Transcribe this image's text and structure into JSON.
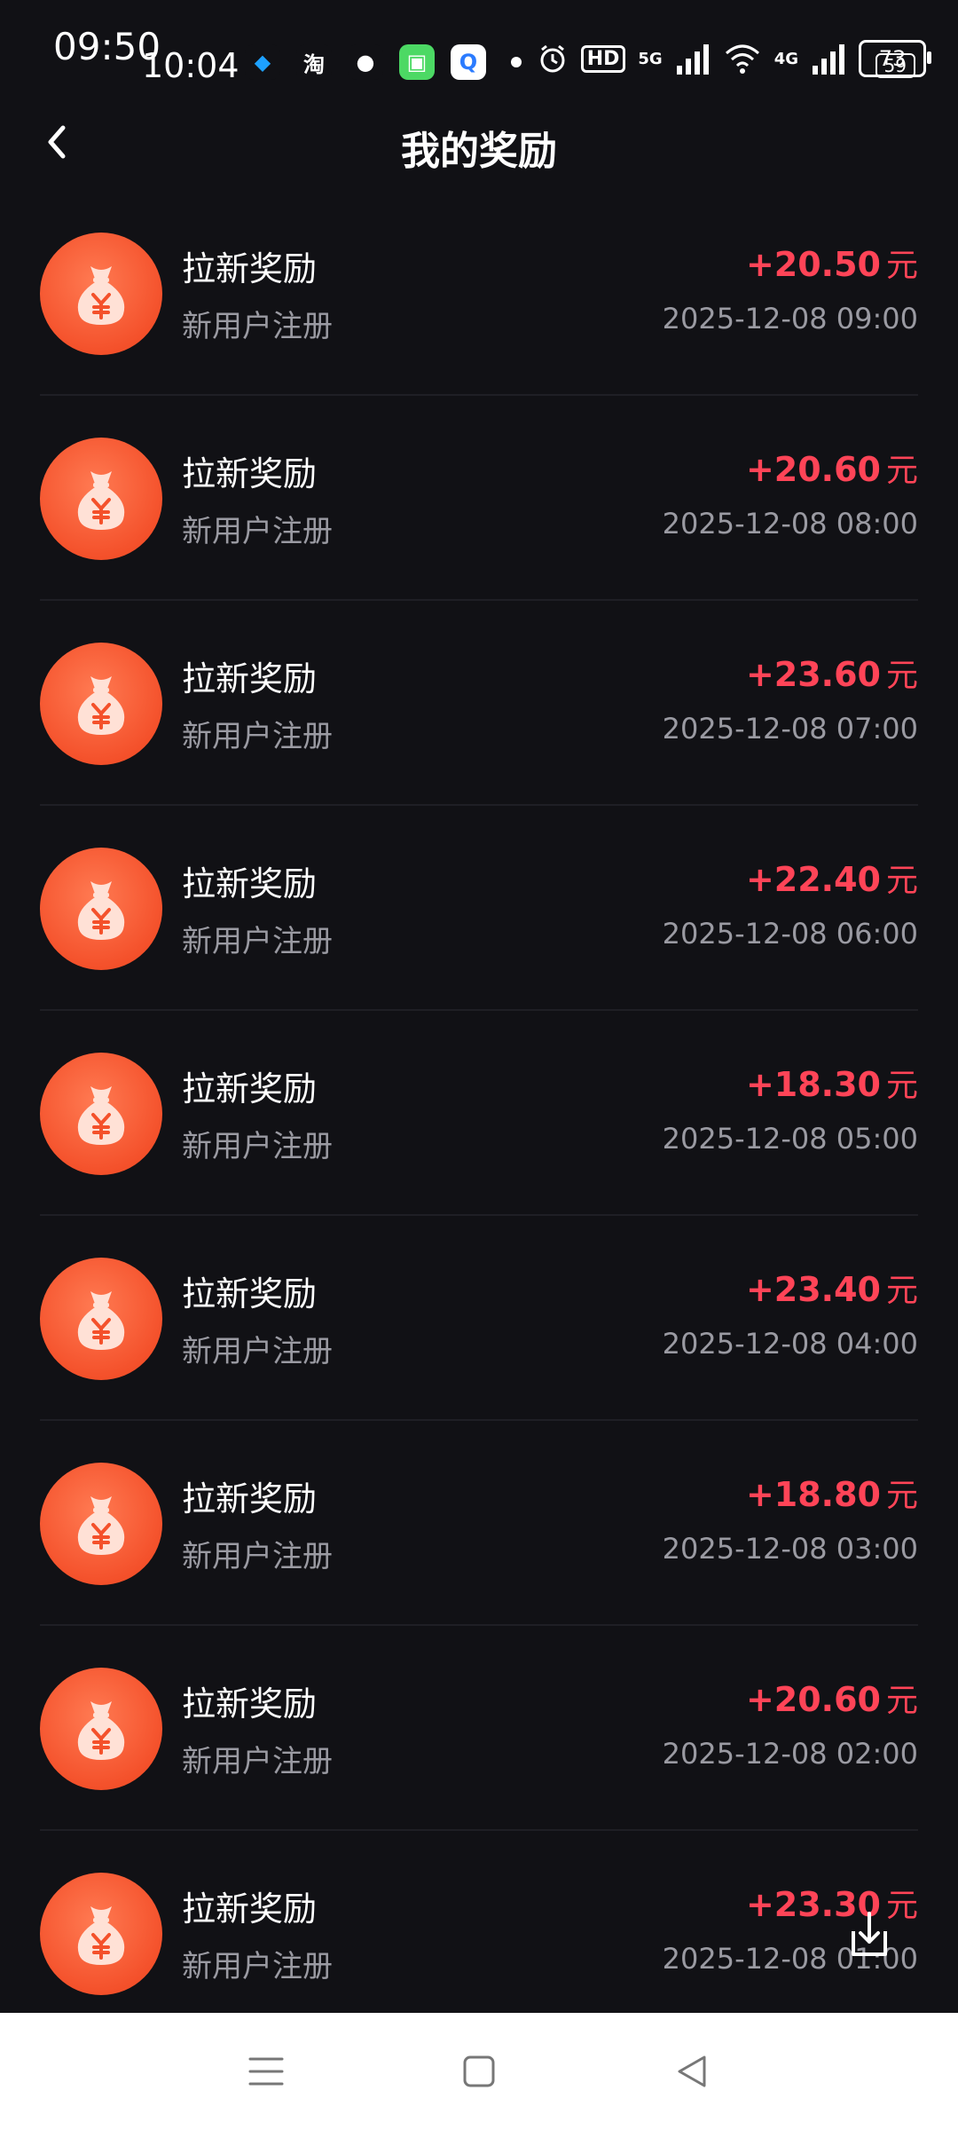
{
  "status_bar": {
    "time_primary": "09:50",
    "time_secondary": "10:04",
    "app_icons": [
      {
        "name": "qq-icon",
        "glyph": "◆",
        "bg": "#111115",
        "fg": "#1da1ff"
      },
      {
        "name": "taobao-icon",
        "glyph": "淘",
        "bg": "#111115",
        "fg": "#ffffff"
      },
      {
        "name": "wechat-icon",
        "glyph": "●",
        "bg": "#111115",
        "fg": "#ffffff"
      },
      {
        "name": "green-app-icon",
        "glyph": "▣",
        "bg": "#4cd964",
        "fg": "#ffffff"
      },
      {
        "name": "search-app-icon",
        "glyph": "Q",
        "bg": "#ffffff",
        "fg": "#2b7bff"
      }
    ],
    "hd_label": "HD",
    "network_5g": "5G",
    "network_4g": "4G",
    "battery_level": "73",
    "battery_secondary": "59"
  },
  "header": {
    "title": "我的奖励"
  },
  "rewards": [
    {
      "title": "拉新奖励",
      "subtitle": "新用户注册",
      "amount": "+20.50",
      "unit": "元",
      "time": "2025-12-08 09:00"
    },
    {
      "title": "拉新奖励",
      "subtitle": "新用户注册",
      "amount": "+20.60",
      "unit": "元",
      "time": "2025-12-08 08:00"
    },
    {
      "title": "拉新奖励",
      "subtitle": "新用户注册",
      "amount": "+23.60",
      "unit": "元",
      "time": "2025-12-08 07:00"
    },
    {
      "title": "拉新奖励",
      "subtitle": "新用户注册",
      "amount": "+22.40",
      "unit": "元",
      "time": "2025-12-08 06:00"
    },
    {
      "title": "拉新奖励",
      "subtitle": "新用户注册",
      "amount": "+18.30",
      "unit": "元",
      "time": "2025-12-08 05:00"
    },
    {
      "title": "拉新奖励",
      "subtitle": "新用户注册",
      "amount": "+23.40",
      "unit": "元",
      "time": "2025-12-08 04:00"
    },
    {
      "title": "拉新奖励",
      "subtitle": "新用户注册",
      "amount": "+18.80",
      "unit": "元",
      "time": "2025-12-08 03:00"
    },
    {
      "title": "拉新奖励",
      "subtitle": "新用户注册",
      "amount": "+20.60",
      "unit": "元",
      "time": "2025-12-08 02:00"
    },
    {
      "title": "拉新奖励",
      "subtitle": "新用户注册",
      "amount": "+23.30",
      "unit": "元",
      "time": "2025-12-08 01:00"
    }
  ],
  "colors": {
    "background": "#111115",
    "amount": "#ff4457",
    "avatar": "#f4512b",
    "muted_text": "#9a9aa2"
  },
  "icons": {
    "avatar": "money-bag-icon",
    "back": "chevron-left-icon",
    "download": "download-icon",
    "nav_menu": "menu-icon",
    "nav_home": "home-icon",
    "nav_back": "back-triangle-icon"
  }
}
